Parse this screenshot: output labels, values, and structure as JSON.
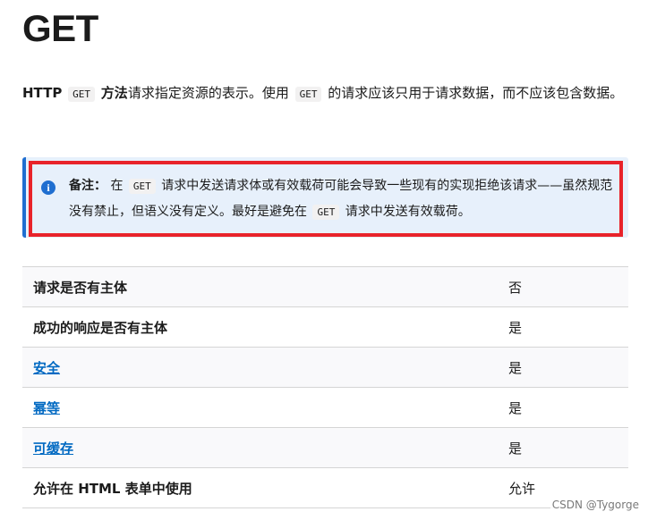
{
  "page": {
    "title": "GET"
  },
  "intro": {
    "http": "HTTP",
    "code_1": "GET",
    "method_label": "方法",
    "text_1": "请求指定资源的表示。使用",
    "code_2": "GET",
    "text_2": "的请求应该只用于请求数据，而不应该包含数据。"
  },
  "note": {
    "label": "备注：",
    "text_1": "在",
    "code_1": "GET",
    "text_2": "请求中发送请求体或有效载荷可能会导致一些现有的实现拒绝该请求——虽然规范没有禁止，但语义没有定义。最好是避免在",
    "code_2": "GET",
    "text_3": "请求中发送有效载荷。",
    "accent_color": "#1f6ed0",
    "highlight_color": "#e8232a"
  },
  "table": {
    "rows": [
      {
        "key": "请求是否有主体",
        "value": "否",
        "link": false
      },
      {
        "key": "成功的响应是否有主体",
        "value": "是",
        "link": false
      },
      {
        "key": "安全",
        "value": "是",
        "link": true
      },
      {
        "key": "幂等",
        "value": "是",
        "link": true
      },
      {
        "key": "可缓存",
        "value": "是",
        "link": true
      },
      {
        "key": "允许在 HTML 表单中使用",
        "value": "允许",
        "link": false
      }
    ],
    "link_color": "#0069c2"
  },
  "watermark": "CSDN @Tygorge"
}
